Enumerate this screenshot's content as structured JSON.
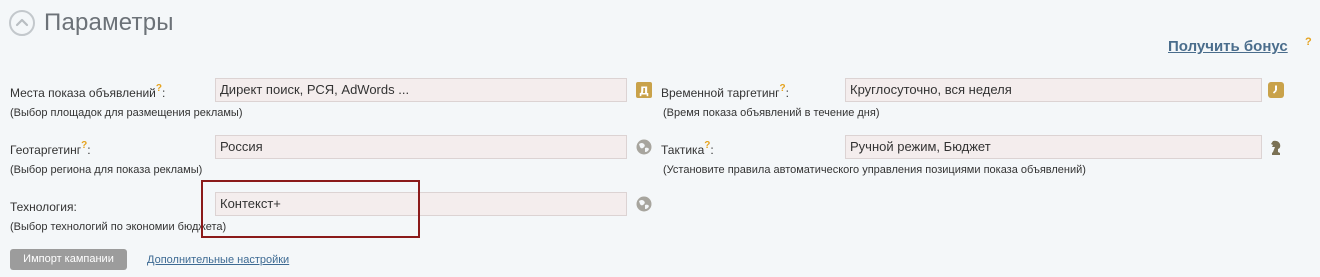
{
  "header": {
    "title": "Параметры",
    "bonus_link": "Получить бонус",
    "bonus_q": "?"
  },
  "fields": {
    "placements": {
      "label": "Места показа объявлений",
      "q": "?",
      "colon": ":",
      "hint": "(Выбор площадок для размещения рекламы)",
      "value": "Директ поиск, РСЯ, AdWords ...",
      "icon": "direct-letter-icon",
      "icon_char": "Д"
    },
    "time_targeting": {
      "label": "Временной таргетинг",
      "q": "?",
      "colon": ":",
      "hint": "(Время показа объявлений в течение дня)",
      "value": "Круглосуточно, вся неделя",
      "icon": "clock-icon"
    },
    "geo_targeting": {
      "label": "Геотаргетинг",
      "q": "?",
      "colon": ":",
      "hint": "(Выбор региона для показа рекламы)",
      "value": "Россия",
      "icon": "globe-icon"
    },
    "tactics": {
      "label": "Тактика",
      "q": "?",
      "colon": ":",
      "hint": "(Установите правила автоматического управления позициями показа объявлений)",
      "value": "Ручной режим, Бюджет",
      "icon": "chess-knight-icon"
    },
    "technology": {
      "label": "Технология:",
      "hint": "(Выбор технологий по экономии бюджета)",
      "value": "Контекст+",
      "icon": "globe-icon"
    }
  },
  "footer": {
    "import_button": "Импорт кампании",
    "more_settings_link": "Дополнительные настройки"
  },
  "colors": {
    "accent_q": "#e5a31f",
    "icon_gold": "#c9a24a",
    "link": "#4a6d8c",
    "highlight": "#8b1a1a"
  }
}
